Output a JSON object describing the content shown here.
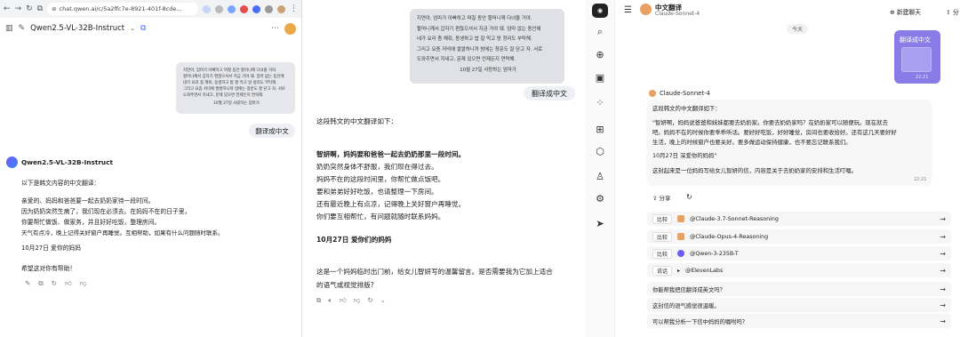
{
  "browser": {
    "url": "chat.qwen.ai/c/5a2ffc7e-8921-401f-8cde..."
  },
  "qwen": {
    "model": "Qwen2.5-VL-32B-Instruct",
    "image_text": [
      "지연아, 엄마가 아빠하고 며칠 동안 할머니께 다녀올 거야.",
      "할머니께서 갑자기 편찮으셔서 지금 가야 돼. 엄마 없는 동안에",
      "네가 요리 좀 해줘, 동생하고 밥 잘 먹고 방 정리도 부탁해.",
      "그리고 요즘 저녁에 쌀쌀하니까 밤에는 창문도 잘 닫고 자. 서로",
      "도와주면서 지내고, 문제 있으면 언제든지 연락해.",
      "10월 27일 사랑하는 엄마가"
    ],
    "user_msg": "翻译成中文",
    "bot_name": "Qwen2.5-VL-32B-Instruct",
    "lines": [
      "以下是韩文内容的中文翻译：",
      "亲爱的、妈妈和爸爸要一起去奶奶家待一段时间。",
      "因为奶奶突然生病了，我们现在必须去。在妈妈不在的日子里，",
      "你要帮忙做饭、做家务，并且好好吃饭，整理房间。",
      "天气有点冷，晚上记得关好窗户再睡觉。互相帮助，如果有什么问题随时联系。",
      "10月27日 爱你的妈妈",
      "希望这对你有帮助！"
    ]
  },
  "middle": {
    "image_text": [
      "지연아, 엄마가 아빠하고 며칠 동안 할머니께 다녀올 거야.",
      "할머니께서 갑자기 편찮으셔서 지금 가야 돼. 엄마 없는 동안에",
      "네가 요리 좀 해줘, 동생하고 밥 잘 먹고 방 정리도 부탁해.",
      "그리고 요즘 저녁에 쌀쌀하니까 밤에는 창문도 잘 닫고 자. 서로",
      "도와주면서 지내고, 문제 있으면 언제든지 연락해.",
      "10월 27일 사랑하는 엄마가"
    ],
    "user_msg": "翻译成中文",
    "lines": [
      "这段韩文的中文翻译如下：",
      "智妍啊，妈妈要和爸爸一起去奶奶那里一段时间。",
      "奶奶突然身体不舒服，我们现在得过去。",
      "妈妈不在的这段时间里，你帮忙做点饭吧。",
      "要和弟弟好好吃饭，也请整理一下房间。",
      "还有最近晚上有点凉，记得晚上关好窗户再睡觉。",
      "你们要互相帮忙，有问题就随时联系妈妈。",
      "10月27日 爱你们的妈妈",
      "这是一个妈妈临时出门前，给女儿智妍写的温馨留言。是否需要我为它加上适合",
      "的语气或视觉排版?"
    ]
  },
  "poe": {
    "title": "中文翻译",
    "subtitle": "Claude-Sonnet-4",
    "new_chat": "新建聊天",
    "share_top": "分",
    "date": "今天",
    "user_msg": "翻译成中文",
    "user_time": "22:21",
    "bot": "Claude-Sonnet-4",
    "lines": [
      "这段韩文的中文翻译如下：",
      "\"智妍啊，妈妈说爸爸和妹妹都要去奶奶家。你要去奶奶家吗？在奶奶家可以随便玩。现在就去",
      "吧。妈妈不在的时候你要乖乖听话。要好好吃饭，好好睡觉，房间也要收拾好。还有这几天要好好",
      "生活，晚上的时候窗户也要关好。要多做运动保持健康，也不要忘记联系我们。",
      "10月27日 深爱你的妈妈\"",
      "这封起来是一位妈妈写给女儿智妍的信，内容是关于去奶奶家的安排和生活叮嘱。"
    ],
    "bot_time": "22:21",
    "share": "分享",
    "compare": [
      {
        "tag": "比较",
        "name": "@Claude-3.7-Sonnet-Reasoning"
      },
      {
        "tag": "比较",
        "name": "@Claude-Opus-4-Reasoning"
      },
      {
        "tag": "比较",
        "name": "@Qwen-3-235B-T"
      },
      {
        "tag": "说话",
        "name": "@ElevenLabs"
      }
    ],
    "suggest": [
      "你能帮我把信翻译成英文吗？",
      "这封信的语气感觉很温暖。",
      "可以帮我分析一下信中妈妈的嘱咐吗？"
    ]
  }
}
